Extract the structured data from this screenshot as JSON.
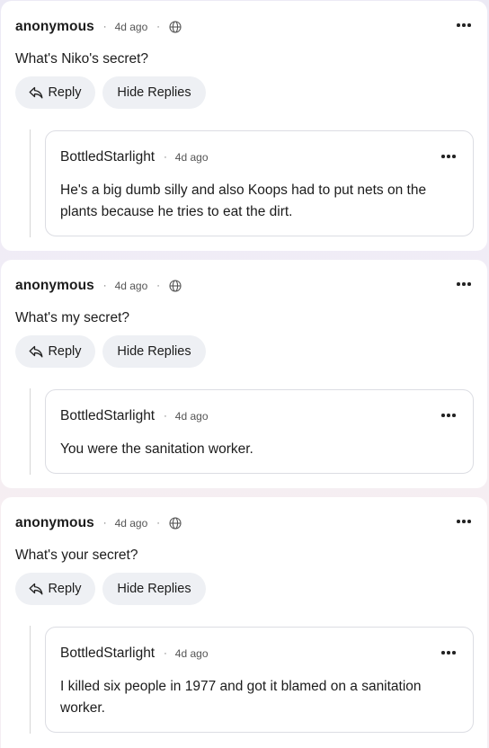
{
  "comments": [
    {
      "author": "anonymous",
      "age": "4d ago",
      "text": "What's Niko's secret?",
      "reply_label": "Reply",
      "hide_label": "Hide Replies",
      "reply": {
        "author": "BottledStarlight",
        "age": "4d ago",
        "text": "He's a big dumb silly and also Koops had to put nets on the plants because he tries to eat the dirt."
      }
    },
    {
      "author": "anonymous",
      "age": "4d ago",
      "text": "What's my secret?",
      "reply_label": "Reply",
      "hide_label": "Hide Replies",
      "reply": {
        "author": "BottledStarlight",
        "age": "4d ago",
        "text": "You were the sanitation worker."
      }
    },
    {
      "author": "anonymous",
      "age": "4d ago",
      "text": "What's your secret?",
      "reply_label": "Reply",
      "hide_label": "Hide Replies",
      "reply": {
        "author": "BottledStarlight",
        "age": "4d ago",
        "text": "I killed six people in 1977 and got it blamed on a sanitation worker."
      }
    }
  ],
  "separator": "·",
  "icons": {
    "globe": "globe-icon",
    "more": "more-options-icon",
    "reply": "reply-arrow-icon"
  }
}
